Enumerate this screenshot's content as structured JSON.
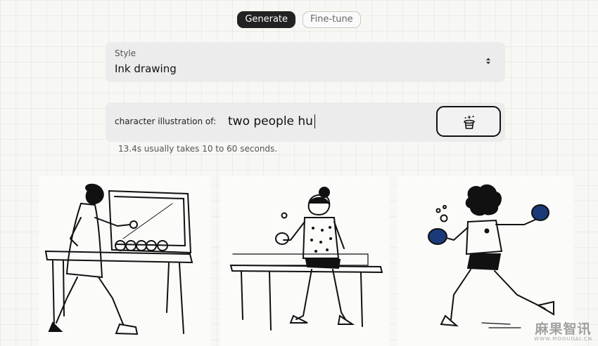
{
  "tabs": [
    {
      "label": "Generate",
      "active": true
    },
    {
      "label": "Fine-tune",
      "active": false
    }
  ],
  "style_selector": {
    "label": "Style",
    "value": "Ink drawing",
    "icon": "sort-arrows-icon"
  },
  "prompt": {
    "prefix": "character illustration of:",
    "value": "two people hu"
  },
  "generate_button": {
    "icon": "magic-hat-icon"
  },
  "timing_text": "13.4s usually takes 10 to 60 seconds.",
  "images": [
    {
      "subject": "ink drawing of a girl playing table tennis with ball machine"
    },
    {
      "subject": "ink drawing of a girl with ponytail at a ping pong table"
    },
    {
      "subject": "ink drawing of a curly-haired player swinging a paddle"
    }
  ],
  "watermark": {
    "main": "麻果智讯",
    "sub": "WWW.MOGUOAI.CN"
  },
  "colors": {
    "accent": "#222222",
    "panel": "#ececec",
    "background": "#f7f7f4"
  }
}
